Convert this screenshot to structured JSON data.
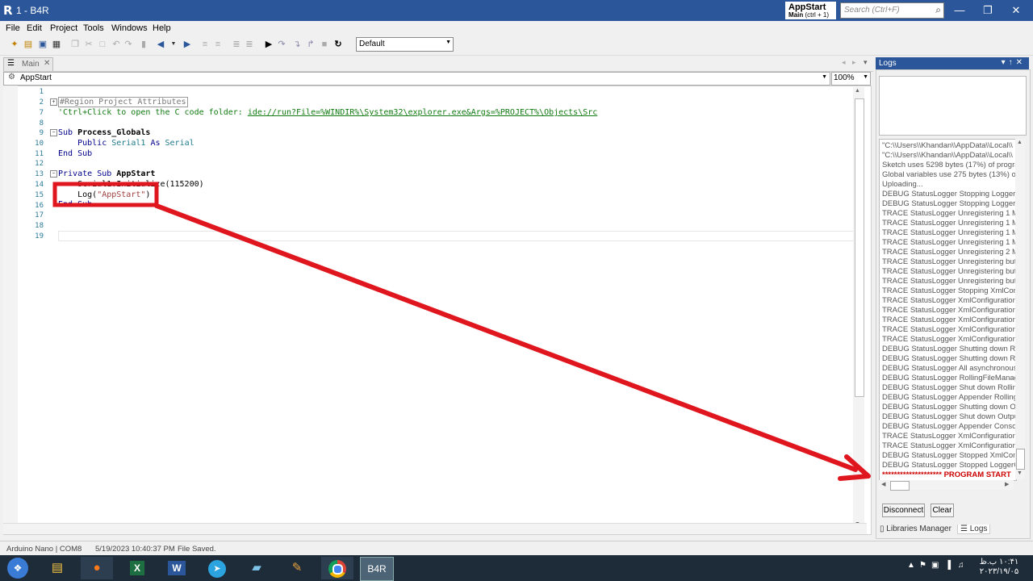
{
  "window": {
    "title": "1 - B4R",
    "app_icon": "R"
  },
  "badge": {
    "module": "AppStart",
    "label": "Main",
    "shortcut": "(ctrl + 1)"
  },
  "search": {
    "placeholder": "Search (Ctrl+F)"
  },
  "menu": [
    "File",
    "Edit",
    "Project",
    "Tools",
    "Windows",
    "Help"
  ],
  "toolbar": {
    "config_value": "Default"
  },
  "editor": {
    "tab_label": "Main",
    "sub_dropdown": "AppStart",
    "zoom": "100%",
    "line_numbers": [
      "1",
      "2",
      "7",
      "8",
      "9",
      "10",
      "11",
      "12",
      "13",
      "14",
      "15",
      "16",
      "17",
      "18",
      "19"
    ],
    "lines": {
      "region": "#Region Project Attributes",
      "comment_prefix": "'Ctrl+Click to open the C code folder: ",
      "comment_link": "ide://run?File=%WINDIR%\\System32\\explorer.exe&Args=%PROJECT%\\Objects\\Src",
      "sub_kw": "Sub",
      "sub_name": "Process_Globals",
      "public_kw": "Public",
      "var_name": "Serial1",
      "as_kw": "As",
      "type_name": "Serial",
      "end_sub": "End Sub",
      "private_kw": "Private",
      "private_sub_kw": "Sub",
      "private_sub_name": "AppStart",
      "line14": "Serial1.Initialize(115200)",
      "log_call_pre": "Log(",
      "log_arg": "\"AppStart\"",
      "log_call_post": ")",
      "line16": "End Sub"
    }
  },
  "logs": {
    "title": "Logs",
    "lines": [
      "\"C:\\\\Users\\\\Khandan\\\\AppData\\\\Local\\\\",
      "\"C:\\\\Users\\\\Khandan\\\\AppData\\\\Local\\\\",
      "Sketch uses 5298 bytes (17%) of program",
      "Global variables use 275 bytes (13%) of",
      "Uploading...",
      "DEBUG StatusLogger Stopping LoggerC",
      "DEBUG StatusLogger Stopping LoggerC",
      "TRACE StatusLogger Unregistering 1 M",
      "TRACE StatusLogger Unregistering 1 M",
      "TRACE StatusLogger Unregistering 1 M",
      "TRACE StatusLogger Unregistering 1 M",
      "TRACE StatusLogger Unregistering 2 M",
      "TRACE StatusLogger Unregistering but",
      "TRACE StatusLogger Unregistering but",
      "TRACE StatusLogger Unregistering but",
      "TRACE StatusLogger Stopping XmlCon",
      "TRACE StatusLogger XmlConfiguration",
      "TRACE StatusLogger XmlConfiguration",
      "TRACE StatusLogger XmlConfiguration",
      "TRACE StatusLogger XmlConfiguration",
      "TRACE StatusLogger XmlConfiguration",
      "DEBUG StatusLogger Shutting down Ro",
      "DEBUG StatusLogger Shutting down Ro",
      "DEBUG StatusLogger All asynchronous",
      "DEBUG StatusLogger RollingFileManag",
      "DEBUG StatusLogger Shut down Rollin",
      "DEBUG StatusLogger Appender Rolling",
      "DEBUG StatusLogger Shutting down O",
      "DEBUG StatusLogger Shut down Outpu",
      "DEBUG StatusLogger Appender Consol",
      "TRACE StatusLogger XmlConfiguration",
      "TRACE StatusLogger XmlConfiguration",
      "DEBUG StatusLogger Stopped XmlConf",
      "DEBUG StatusLogger Stopped LoggerC"
    ],
    "program_start": "******************** PROGRAM START",
    "disconnect": "Disconnect",
    "clear": "Clear",
    "tab_libraries": "Libraries Manager",
    "tab_logs": "Logs"
  },
  "status": {
    "board": "Arduino Nano | COM8",
    "time": "5/19/2023 10:40:37 PM",
    "message": "File Saved."
  },
  "taskbar": {
    "b4r_label": "B4R",
    "clock_time": "۱۰:۴۱ ب.ظ",
    "clock_date": "۲۰۲۳/۱۹/۰۵"
  },
  "colors": {
    "accent": "#2b579a",
    "annotation": "#e0161e"
  }
}
